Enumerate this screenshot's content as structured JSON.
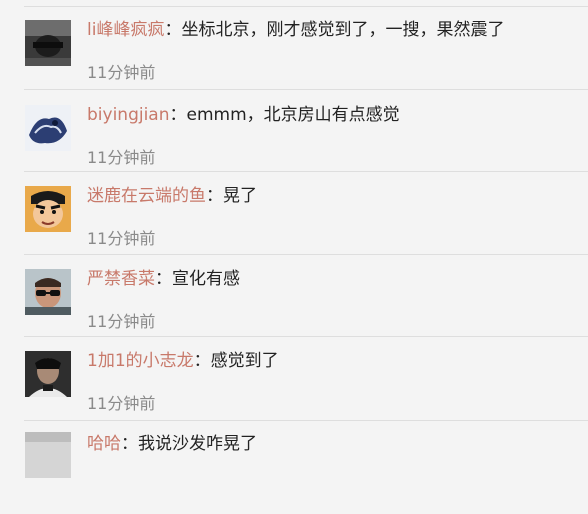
{
  "comments": [
    {
      "username": "li峰峰疯疯",
      "colon": "：",
      "text": "坐标北京，刚才感觉到了，一搜，果然震了",
      "time": "11分钟前",
      "avatar_icon": "avatar-dark-photo"
    },
    {
      "username": "biyingjian",
      "colon": "：",
      "text": "emmm，北京房山有点感觉",
      "time": "11分钟前",
      "avatar_icon": "avatar-blue-sketch"
    },
    {
      "username": "迷鹿在云端的鱼",
      "colon": "：",
      "text": "晃了",
      "time": "11分钟前",
      "avatar_icon": "avatar-cartoon-face"
    },
    {
      "username": "严禁香菜",
      "colon": "：",
      "text": "宣化有感",
      "time": "11分钟前",
      "avatar_icon": "avatar-man-sunglasses"
    },
    {
      "username": "1加1的小志龙",
      "colon": "：",
      "text": "感觉到了",
      "time": "11分钟前",
      "avatar_icon": "avatar-person-photo"
    },
    {
      "username": "哈哈",
      "colon": "：",
      "text": "我说沙发咋晃了",
      "time": "",
      "avatar_icon": "avatar-partial"
    }
  ],
  "colors": {
    "username": "#c8796a",
    "text": "#222222",
    "time": "#8a8a8a",
    "background": "#f4f4f4",
    "divider": "#dedede"
  }
}
